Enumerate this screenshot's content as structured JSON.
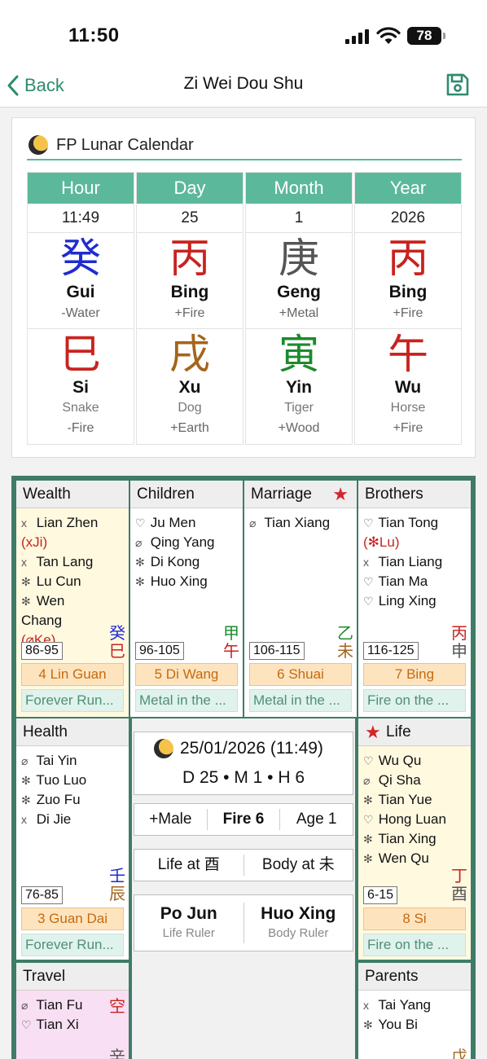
{
  "status_bar": {
    "time": "11:50",
    "battery": "78"
  },
  "nav": {
    "back_label": "Back",
    "title": "Zi Wei Dou Shu"
  },
  "calendar": {
    "title": "FP Lunar Calendar",
    "pillars": [
      {
        "head": "Hour",
        "value": "11:49",
        "stem": {
          "char": "癸",
          "pinyin": "Gui",
          "element": "-Water",
          "color": "#1f2bd1"
        },
        "branch": {
          "char": "巳",
          "pinyin": "Si",
          "animal": "Snake",
          "element": "-Fire",
          "color": "#c8231f"
        }
      },
      {
        "head": "Day",
        "value": "25",
        "stem": {
          "char": "丙",
          "pinyin": "Bing",
          "element": "+Fire",
          "color": "#c8231f"
        },
        "branch": {
          "char": "戌",
          "pinyin": "Xu",
          "animal": "Dog",
          "element": "+Earth",
          "color": "#a3651c"
        }
      },
      {
        "head": "Month",
        "value": "1",
        "stem": {
          "char": "庚",
          "pinyin": "Geng",
          "element": "+Metal",
          "color": "#555555"
        },
        "branch": {
          "char": "寅",
          "pinyin": "Yin",
          "animal": "Tiger",
          "element": "+Wood",
          "color": "#1d8a2c"
        }
      },
      {
        "head": "Year",
        "value": "2026",
        "stem": {
          "char": "丙",
          "pinyin": "Bing",
          "element": "+Fire",
          "color": "#c8231f"
        },
        "branch": {
          "char": "午",
          "pinyin": "Wu",
          "animal": "Horse",
          "element": "+Fire",
          "color": "#c8231f"
        }
      }
    ]
  },
  "palaces": {
    "wealth": {
      "title": "Wealth",
      "stars": [
        {
          "mark": "x",
          "name": "Lian Zhen",
          "mut": "(xJi)"
        },
        {
          "mark": "x",
          "name": "Tan Lang"
        },
        {
          "mark": "✻",
          "name": "Lu Cun"
        },
        {
          "mark": "✻",
          "name": "Wen Chang",
          "mut": "(⌀Ke)"
        }
      ],
      "stem": "癸",
      "branch": "巳",
      "age": "86-95",
      "cycle": "4 Lin Guan",
      "fortune": "Forever Run..."
    },
    "children": {
      "title": "Children",
      "stars": [
        {
          "mark": "♡",
          "name": "Ju Men"
        },
        {
          "mark": "⌀",
          "name": "Qing Yang"
        },
        {
          "mark": "✻",
          "name": "Di Kong"
        },
        {
          "mark": "✻",
          "name": "Huo Xing"
        }
      ],
      "stem": "甲",
      "branch": "午",
      "age": "96-105",
      "cycle": "5 Di Wang",
      "fortune": "Metal in the ..."
    },
    "marriage": {
      "title": "Marriage",
      "stars": [
        {
          "mark": "⌀",
          "name": "Tian Xiang"
        }
      ],
      "stem": "乙",
      "branch": "未",
      "age": "106-115",
      "cycle": "6 Shuai",
      "fortune": "Metal in the ..."
    },
    "brothers": {
      "title": "Brothers",
      "stars": [
        {
          "mark": "♡",
          "name": "Tian Tong",
          "mut": "(✻Lu)"
        },
        {
          "mark": "x",
          "name": "Tian Liang"
        },
        {
          "mark": "♡",
          "name": "Tian Ma"
        },
        {
          "mark": "♡",
          "name": "Ling Xing"
        }
      ],
      "stem": "丙",
      "branch": "申",
      "age": "116-125",
      "cycle": "7 Bing",
      "fortune": "Fire on the ..."
    },
    "health": {
      "title": "Health",
      "stars": [
        {
          "mark": "⌀",
          "name": "Tai Yin"
        },
        {
          "mark": "✻",
          "name": "Tuo Luo"
        },
        {
          "mark": "✻",
          "name": "Zuo Fu"
        },
        {
          "mark": "x",
          "name": "Di Jie"
        }
      ],
      "stem": "壬",
      "branch": "辰",
      "age": "76-85",
      "cycle": "3 Guan Dai",
      "fortune": "Forever Run..."
    },
    "life": {
      "title": "Life",
      "stars": [
        {
          "mark": "♡",
          "name": "Wu Qu"
        },
        {
          "mark": "⌀",
          "name": "Qi Sha"
        },
        {
          "mark": "✻",
          "name": "Tian Yue"
        },
        {
          "mark": "♡",
          "name": "Hong Luan"
        },
        {
          "mark": "✻",
          "name": "Tian Xing"
        },
        {
          "mark": "✻",
          "name": "Wen Qu"
        }
      ],
      "stem": "丁",
      "branch": "酉",
      "age": "6-15",
      "cycle": "8 Si",
      "fortune": "Fire on the ..."
    },
    "travel": {
      "title": "Travel",
      "stars": [
        {
          "mark": "⌀",
          "name": "Tian Fu"
        },
        {
          "mark": "♡",
          "name": "Tian Xi"
        }
      ],
      "corner": "空",
      "stem": "辛"
    },
    "parents": {
      "title": "Parents",
      "stars": [
        {
          "mark": "x",
          "name": "Tai Yang"
        },
        {
          "mark": "✻",
          "name": "You Bi"
        }
      ],
      "stem": "戊"
    }
  },
  "center": {
    "date": "25/01/2026 (11:49)",
    "dmh": "D 25 • M 1 • H 6",
    "gender": "+Male",
    "element": "Fire 6",
    "age": "Age 1",
    "life_at": "Life at 酉",
    "body_at": "Body at 未",
    "life_ruler_star": "Po Jun",
    "life_ruler_label": "Life Ruler",
    "body_ruler_star": "Huo Xing",
    "body_ruler_label": "Body Ruler"
  },
  "colors": {
    "accent": "#2e8b6e",
    "header_green": "#5cb89a",
    "chart_border": "#3f7c67",
    "highlight_red": "#d4242a"
  }
}
